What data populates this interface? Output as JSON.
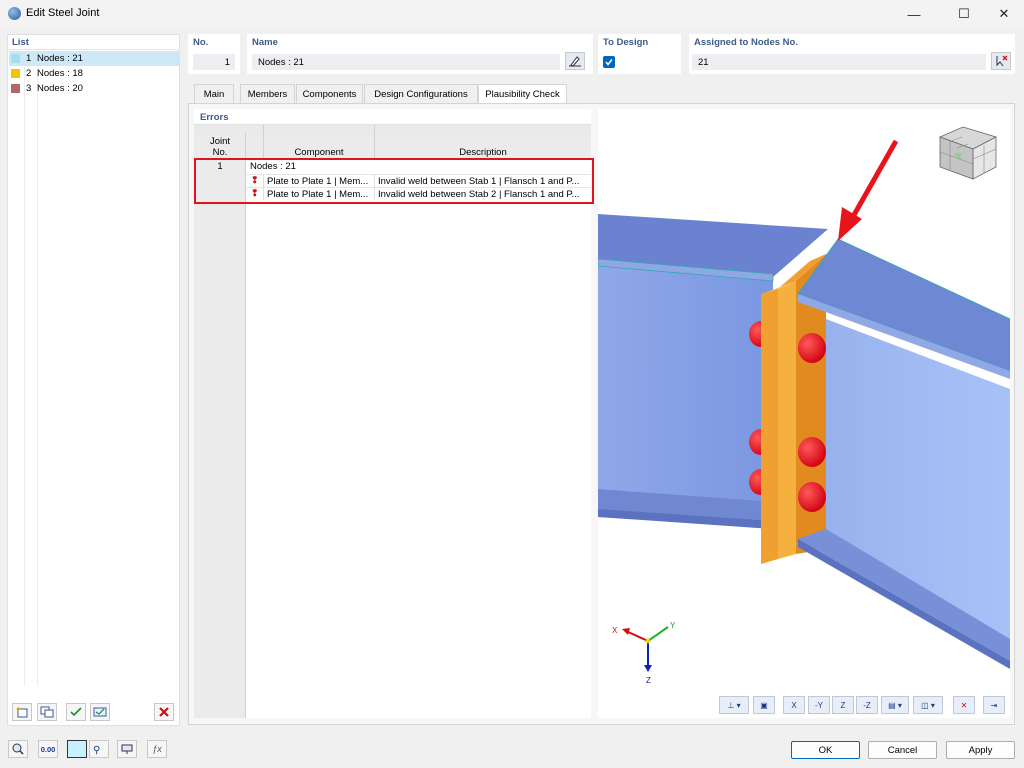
{
  "window": {
    "title": "Edit Steel Joint",
    "minimize": "—",
    "maximize": "☐",
    "close": "✕"
  },
  "list": {
    "header": "List",
    "items": [
      {
        "num": "1",
        "label": "Nodes : 21",
        "color": "#a8dcef"
      },
      {
        "num": "2",
        "label": "Nodes : 18",
        "color": "#f5c400"
      },
      {
        "num": "3",
        "label": "Nodes : 20",
        "color": "#b06868"
      }
    ]
  },
  "fields": {
    "no_label": "No.",
    "no_value": "1",
    "name_label": "Name",
    "name_value": "Nodes : 21",
    "to_design_label": "To Design",
    "assigned_label": "Assigned to Nodes No.",
    "assigned_value": "21"
  },
  "tabs": [
    "Main",
    "Members",
    "Components",
    "Design Configurations",
    "Plausibility Check"
  ],
  "errors": {
    "header": "Errors",
    "col_joint": "Joint No.",
    "col_joint_l1": "Joint",
    "col_joint_l2": "No.",
    "col_component": "Component",
    "col_description": "Description",
    "group": {
      "joint": "1",
      "label": "Nodes : 21"
    },
    "rows": [
      {
        "component": "Plate to Plate 1 | Mem...",
        "description": "Invalid weld between Stab 1 | Flansch 1 and P..."
      },
      {
        "component": "Plate to Plate 1 | Mem...",
        "description": "Invalid weld between Stab 2 | Flansch 1 and P..."
      }
    ]
  },
  "axes": {
    "x": "X",
    "y": "Y",
    "z": "Z"
  },
  "view_toolbar": [
    "X",
    "-Y",
    "Z",
    "-Z"
  ],
  "footer": {
    "ok": "OK",
    "cancel": "Cancel",
    "apply": "Apply",
    "units": "0.00"
  },
  "colors": {
    "accent": "#0067c0",
    "highlight": "#e0141c",
    "header": "#3d5a8a",
    "steel": "#6f88d4",
    "plate": "#f0a030",
    "bolt": "#e01020"
  }
}
